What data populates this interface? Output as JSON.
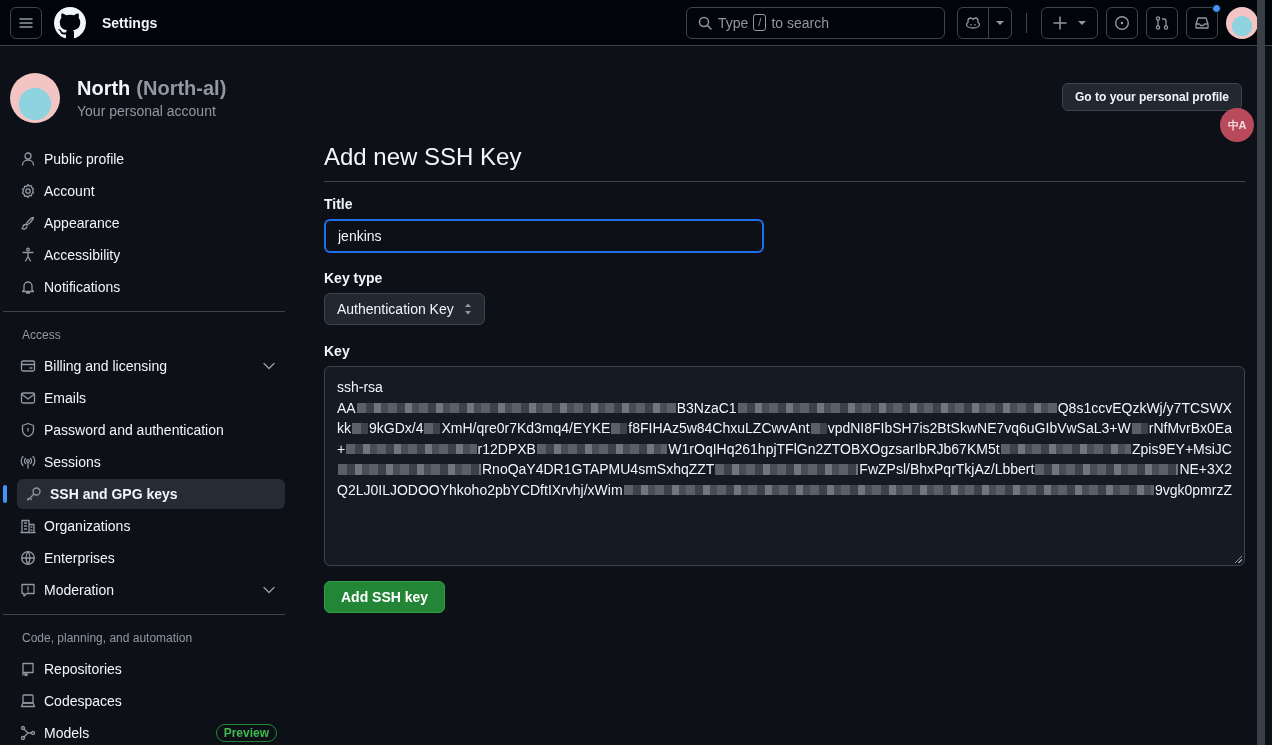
{
  "header": {
    "title": "Settings",
    "search": {
      "prefix": "Type",
      "key": "/",
      "suffix": "to search"
    },
    "inbox_unread": true
  },
  "profile": {
    "name": "North",
    "login": "(North-al)",
    "subtitle": "Your personal account",
    "button": "Go to your personal profile"
  },
  "translate_button": {
    "label": "中A"
  },
  "sidebar": {
    "sections": [
      {
        "items": [
          {
            "label": "Public profile",
            "selected": false,
            "collapsible": false
          },
          {
            "label": "Account",
            "selected": false,
            "collapsible": false
          },
          {
            "label": "Appearance",
            "selected": false,
            "collapsible": false
          },
          {
            "label": "Accessibility",
            "selected": false,
            "collapsible": false
          },
          {
            "label": "Notifications",
            "selected": false,
            "collapsible": false
          }
        ]
      },
      {
        "heading": "Access",
        "items": [
          {
            "label": "Billing and licensing",
            "selected": false,
            "collapsible": true
          },
          {
            "label": "Emails",
            "selected": false,
            "collapsible": false
          },
          {
            "label": "Password and authentication",
            "selected": false,
            "collapsible": false
          },
          {
            "label": "Sessions",
            "selected": false,
            "collapsible": false
          },
          {
            "label": "SSH and GPG keys",
            "selected": true,
            "collapsible": false
          },
          {
            "label": "Organizations",
            "selected": false,
            "collapsible": false
          },
          {
            "label": "Enterprises",
            "selected": false,
            "collapsible": false
          },
          {
            "label": "Moderation",
            "selected": false,
            "collapsible": true
          }
        ]
      },
      {
        "heading": "Code, planning, and automation",
        "items": [
          {
            "label": "Repositories",
            "selected": false,
            "collapsible": false
          },
          {
            "label": "Codespaces",
            "selected": false,
            "collapsible": false
          },
          {
            "label": "Models",
            "selected": false,
            "collapsible": false,
            "badge": "Preview"
          }
        ]
      }
    ]
  },
  "form": {
    "heading": "Add new SSH Key",
    "title_label": "Title",
    "title_value": "jenkins",
    "key_type_label": "Key type",
    "key_type_value": "Authentication Key",
    "key_label": "Key",
    "key_lines": [
      [
        {
          "kind": "text",
          "text": "ssh-rsa"
        }
      ],
      [
        {
          "kind": "text",
          "text": "AA"
        },
        {
          "kind": "blur"
        },
        {
          "kind": "text",
          "text": "B3NzaC1"
        },
        {
          "kind": "blur"
        },
        {
          "kind": "text",
          "text": "Q8s1ccvEQzkWj/y7TCSWX"
        }
      ],
      [
        {
          "kind": "text",
          "text": "kk"
        },
        {
          "kind": "blur"
        },
        {
          "kind": "text",
          "text": "9kGDx/4"
        },
        {
          "kind": "blur"
        },
        {
          "kind": "text",
          "text": "XmH/qre0r7Kd3mq4/EYKE"
        },
        {
          "kind": "blur"
        },
        {
          "kind": "text",
          "text": "f8FIHAz5w84ChxuLZCwvAnt"
        },
        {
          "kind": "blur"
        },
        {
          "kind": "text",
          "text": "vpdNI8FIbSH7is2BtSkwNE7vq6uGIbVwSaL3+W"
        },
        {
          "kind": "blur"
        },
        {
          "kind": "text",
          "text": "rNfMvrBx0Ea"
        }
      ],
      [
        {
          "kind": "text",
          "text": "+"
        },
        {
          "kind": "blur"
        },
        {
          "kind": "text",
          "text": "r12DPXB"
        },
        {
          "kind": "blur"
        },
        {
          "kind": "text",
          "text": "W1rOqIHq261hpjTFlGn2ZTOBXOgzsarIbRJb67KM5t"
        },
        {
          "kind": "blur"
        },
        {
          "kind": "text",
          "text": "Zpis9EY+MsiJC"
        }
      ],
      [
        {
          "kind": "blur"
        },
        {
          "kind": "text",
          "text": "RnoQaY4DR1GTAPMU4smSxhqZZT"
        },
        {
          "kind": "blur"
        },
        {
          "kind": "text",
          "text": "FwZPsl/BhxPqrTkjAz/Lbbert"
        },
        {
          "kind": "blur"
        },
        {
          "kind": "text",
          "text": "NE+3X2"
        }
      ],
      [
        {
          "kind": "text",
          "text": "Q2LJ0ILJODOOYhkoho2pbYCDftIXrvhj/xWim"
        },
        {
          "kind": "blur"
        },
        {
          "kind": "text",
          "text": "9vgk0pmrzZ"
        }
      ]
    ],
    "submit": "Add SSH key"
  }
}
